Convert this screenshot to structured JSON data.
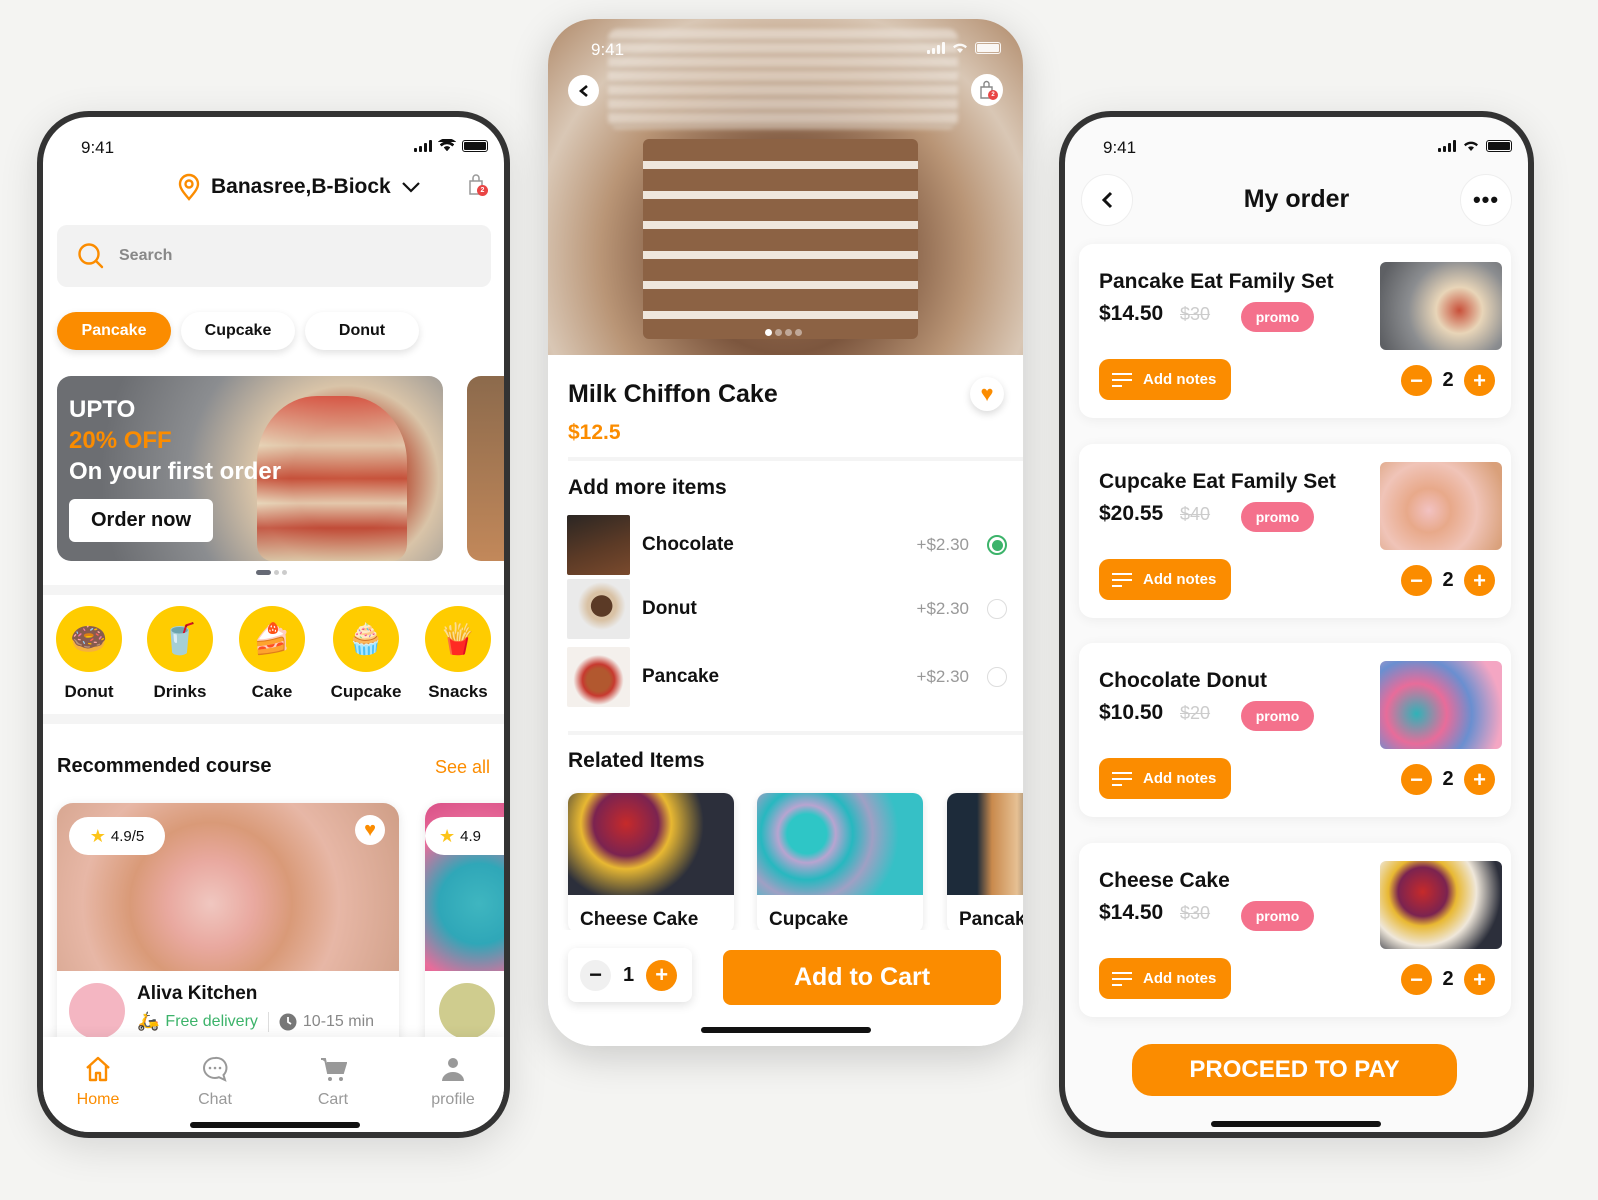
{
  "status_time": "9:41",
  "colors": {
    "accent": "#fb8c00",
    "promo": "#f4718c",
    "green": "#3cb36a",
    "category_bg": "#ffcc00"
  },
  "home": {
    "location": "Banasree,B-Biock",
    "cart_badge": "2",
    "search_placeholder": "Search",
    "chips": [
      {
        "label": "Pancake",
        "active": true
      },
      {
        "label": "Cupcake",
        "active": false
      },
      {
        "label": "Donut",
        "active": false
      }
    ],
    "banner": {
      "line1": "UPTO",
      "line2": "20% OFF",
      "line3": "On your first order",
      "button": "Order now"
    },
    "categories": [
      {
        "label": "Donut",
        "icon": "donut-icon"
      },
      {
        "label": "Drinks",
        "icon": "drink-icon"
      },
      {
        "label": "Cake",
        "icon": "cake-icon"
      },
      {
        "label": "Cupcake",
        "icon": "cupcake-icon"
      },
      {
        "label": "Snacks",
        "icon": "snacks-icon"
      }
    ],
    "recommended_title": "Recommended course",
    "see_all": "See all",
    "cards": [
      {
        "rating": "4.9/5",
        "kitchen": "Aliva Kitchen",
        "delivery": "Free delivery",
        "time": "10-15 min"
      },
      {
        "rating": "4.9"
      }
    ],
    "nav": [
      {
        "label": "Home",
        "icon": "home-icon",
        "active": true
      },
      {
        "label": "Chat",
        "icon": "chat-icon",
        "active": false
      },
      {
        "label": "Cart",
        "icon": "cart-icon",
        "active": false
      },
      {
        "label": "profile",
        "icon": "profile-icon",
        "active": false
      }
    ]
  },
  "detail": {
    "cart_badge": "2",
    "title": "Milk Chiffon Cake",
    "price": "$12.5",
    "add_more_title": "Add more items",
    "addons": [
      {
        "name": "Chocolate",
        "price": "+$2.30",
        "selected": true
      },
      {
        "name": "Donut",
        "price": "+$2.30",
        "selected": false
      },
      {
        "name": "Pancake",
        "price": "+$2.30",
        "selected": false
      }
    ],
    "related_title": "Related Items",
    "related": [
      {
        "name": "Cheese Cake"
      },
      {
        "name": "Cupcake"
      },
      {
        "name": "Pancake"
      }
    ],
    "quantity": "1",
    "add_to_cart": "Add to Cart"
  },
  "order": {
    "title": "My order",
    "items": [
      {
        "name": "Pancake Eat Family Set",
        "price": "$14.50",
        "old_price": "$30",
        "badge": "promo",
        "notes": "Add notes",
        "qty": "2"
      },
      {
        "name": "Cupcake Eat Family Set",
        "price": "$20.55",
        "old_price": "$40",
        "badge": "promo",
        "notes": "Add notes",
        "qty": "2"
      },
      {
        "name": "Chocolate Donut",
        "price": "$10.50",
        "old_price": "$20",
        "badge": "promo",
        "notes": "Add notes",
        "qty": "2"
      },
      {
        "name": "Cheese Cake",
        "price": "$14.50",
        "old_price": "$30",
        "badge": "promo",
        "notes": "Add notes",
        "qty": "2"
      }
    ],
    "proceed": "PROCEED TO PAY"
  }
}
